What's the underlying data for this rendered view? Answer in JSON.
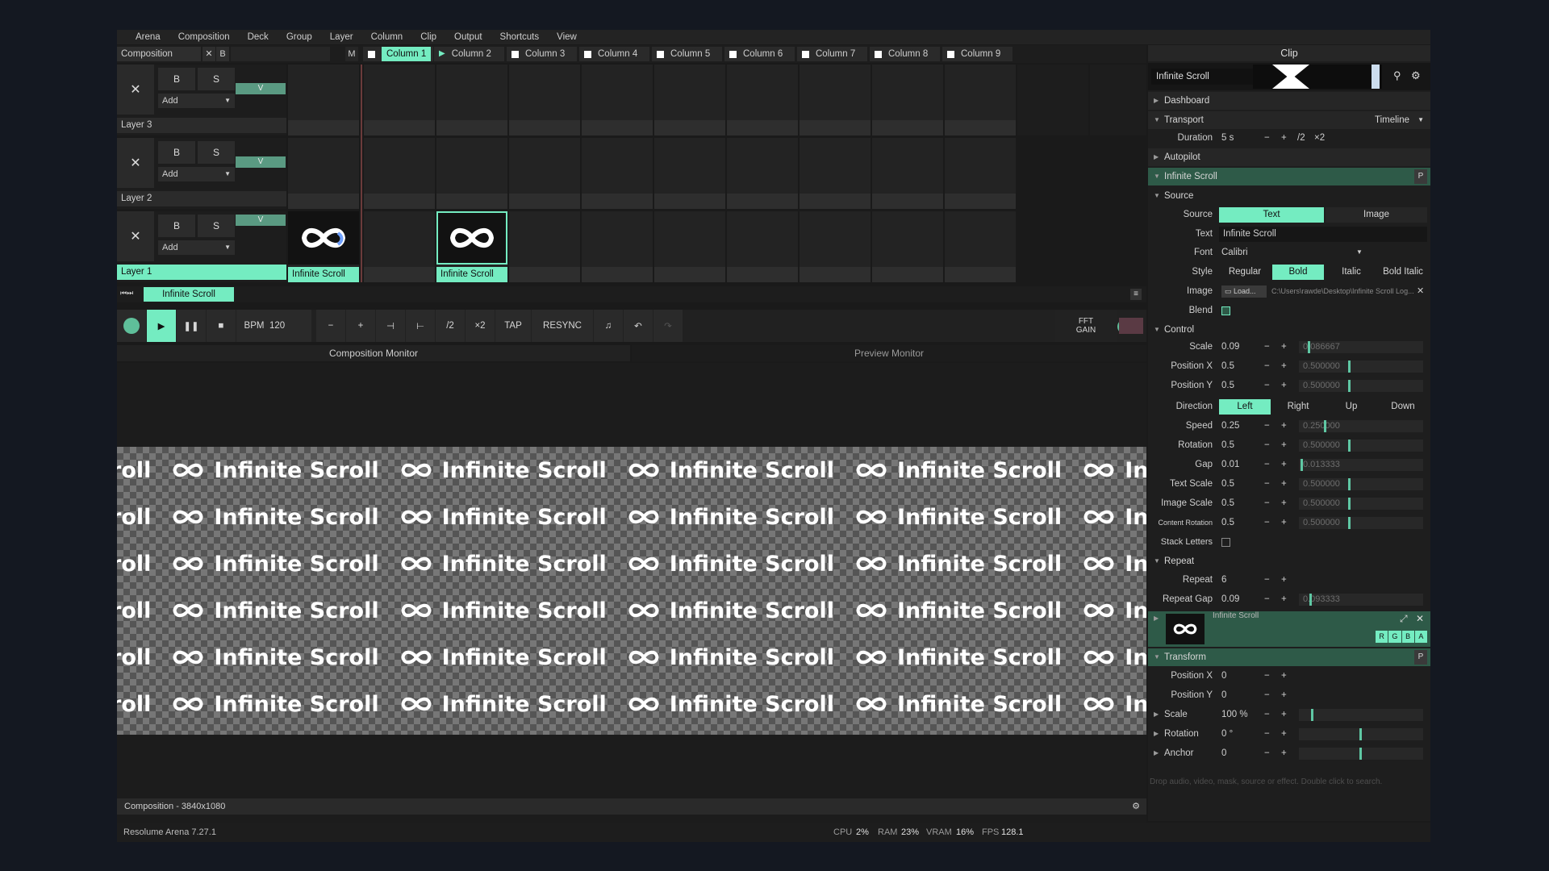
{
  "menu": [
    "Arena",
    "Composition",
    "Deck",
    "Group",
    "Layer",
    "Column",
    "Clip",
    "Output",
    "Shortcuts",
    "View"
  ],
  "comp_tab": {
    "label": "Composition",
    "x": "✕",
    "b": "B",
    "m": "M"
  },
  "columns": [
    "Column 1",
    "Column 2",
    "Column 3",
    "Column 4",
    "Column 5",
    "Column 6",
    "Column 7",
    "Column 8",
    "Column 9"
  ],
  "layers": [
    {
      "name": "Layer 3",
      "b": "B",
      "s": "S",
      "add": "Add",
      "v": "V",
      "x": "✕"
    },
    {
      "name": "Layer 2",
      "b": "B",
      "s": "S",
      "add": "Add",
      "v": "V",
      "x": "✕"
    },
    {
      "name": "Layer 1",
      "b": "B",
      "s": "S",
      "add": "Add",
      "v": "V",
      "x": "✕"
    }
  ],
  "clips": {
    "layer1_col0": "Infinite Scroll",
    "layer1_col2": "Infinite Scroll"
  },
  "deck": {
    "label": "Infinite Scroll"
  },
  "transport": {
    "bpm_label": "BPM",
    "bpm": "120",
    "minus": "−",
    "plus": "+",
    "half": "/2",
    "double": "×2",
    "tap": "TAP",
    "resync": "RESYNC",
    "fft": "FFT",
    "gain": "GAIN"
  },
  "monitors": {
    "composition": "Composition Monitor",
    "preview": "Preview Monitor"
  },
  "scroll_text": "Infinite Scroll",
  "scroll_partial": "roll",
  "comp_status": "Composition - 3840x1080",
  "status": {
    "app": "Resolume Arena 7.27.1",
    "cpu_label": "CPU",
    "cpu": "2%",
    "ram_label": "RAM",
    "ram": "23%",
    "vram_label": "VRAM",
    "vram": "16%",
    "fps_label": "FPS",
    "fps": "128.1"
  },
  "panel": {
    "title": "Clip",
    "clip_name": "Infinite Scroll",
    "dashboard": "Dashboard",
    "transport": "Transport",
    "transport_mode": "Timeline",
    "duration_label": "Duration",
    "duration": "5 s",
    "half": "/2",
    "double": "×2",
    "autopilot": "Autopilot",
    "effect": "Infinite Scroll",
    "source_sect": "Source",
    "source_label": "Source",
    "source_text": "Text",
    "source_image": "Image",
    "text_label": "Text",
    "text_value": "Infinite Scroll",
    "font_label": "Font",
    "font_value": "Calibri",
    "style_label": "Style",
    "styles": [
      "Regular",
      "Bold",
      "Italic",
      "Bold Italic"
    ],
    "image_label": "Image",
    "image_load": "Load...",
    "image_path": "C:\\Users\\rawde\\Desktop\\Infinite Scroll Log...",
    "blend_label": "Blend",
    "control": "Control",
    "params": [
      {
        "label": "Scale",
        "value": "0.09",
        "slider": "0.086667",
        "pos": 0.087
      },
      {
        "label": "Position X",
        "value": "0.5",
        "slider": "0.500000",
        "pos": 0.5
      },
      {
        "label": "Position Y",
        "value": "0.5",
        "slider": "0.500000",
        "pos": 0.5
      }
    ],
    "direction_label": "Direction",
    "directions": [
      "Left",
      "Right",
      "Up",
      "Down"
    ],
    "params2": [
      {
        "label": "Speed",
        "value": "0.25",
        "slider": "0.250000",
        "pos": 0.25
      },
      {
        "label": "Rotation",
        "value": "0.5",
        "slider": "0.500000",
        "pos": 0.5
      },
      {
        "label": "Gap",
        "value": "0.01",
        "slider": "0.013333",
        "pos": 0.013
      },
      {
        "label": "Text Scale",
        "value": "0.5",
        "slider": "0.500000",
        "pos": 0.5
      },
      {
        "label": "Image Scale",
        "value": "0.5",
        "slider": "0.500000",
        "pos": 0.5
      },
      {
        "label": "Content Rotation",
        "value": "0.5",
        "slider": "0.500000",
        "pos": 0.5
      }
    ],
    "stack_label": "Stack Letters",
    "repeat_sect": "Repeat",
    "repeat_label": "Repeat",
    "repeat_value": "6",
    "repeat_gap_label": "Repeat Gap",
    "repeat_gap_value": "0.09",
    "repeat_gap_slider": "0.093333",
    "mini_clip": "Infinite Scroll",
    "rgba": [
      "R",
      "G",
      "B",
      "A"
    ],
    "transform": "Transform",
    "tparams": [
      {
        "label": "Position X",
        "value": "0"
      },
      {
        "label": "Position Y",
        "value": "0"
      },
      {
        "label": "Scale",
        "value": "100 %"
      },
      {
        "label": "Rotation",
        "value": "0 °"
      },
      {
        "label": "Anchor",
        "value": "0"
      }
    ],
    "drop_hint": "Drop audio, video, mask, source or effect. Double click to search."
  },
  "colors": {
    "accent": "#74ecc1",
    "bg": "#1a1a1a",
    "outer": "#141821"
  }
}
